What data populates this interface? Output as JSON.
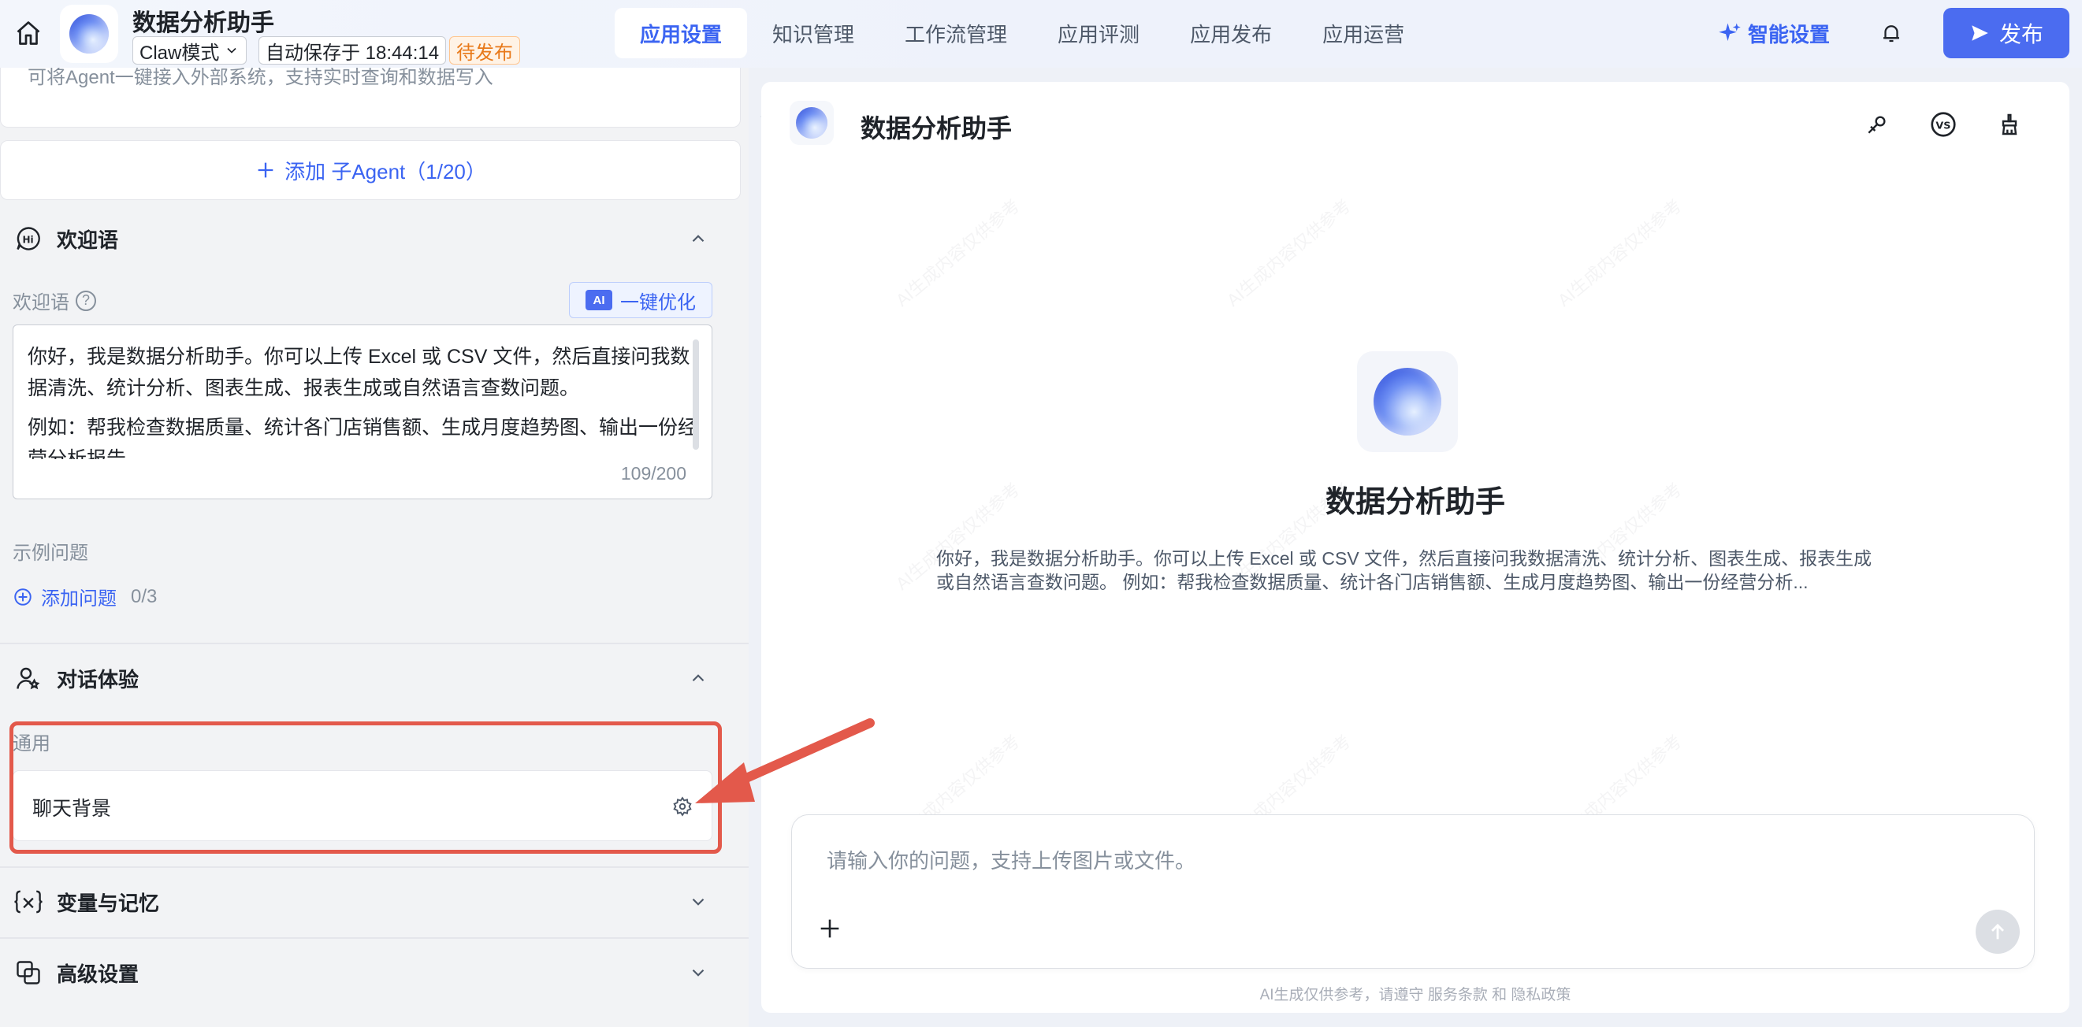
{
  "header": {
    "app_title": "数据分析助手",
    "mode_label": "Claw模式",
    "autosave_text": "自动保存于 18:44:14",
    "status_badge": "待发布",
    "tabs": [
      {
        "label": "应用设置",
        "active": true
      },
      {
        "label": "知识管理",
        "active": false
      },
      {
        "label": "工作流管理",
        "active": false
      },
      {
        "label": "应用评测",
        "active": false
      },
      {
        "label": "应用发布",
        "active": false
      },
      {
        "label": "应用运营",
        "active": false
      }
    ],
    "smart_settings_label": "智能设置",
    "publish_label": "发布",
    "accent_color": "#3b64f2"
  },
  "left": {
    "agent_desc_tail": "可将Agent一键接入外部系统，支持实时查询和数据写入",
    "add_subagent_label": "添加 子Agent（1/20）",
    "welcome_section": {
      "title": "欢迎语",
      "field_label": "欢迎语",
      "optimize_badge": "AI",
      "optimize_label": "一键优化",
      "paragraph1": "你好，我是数据分析助手。你可以上传 Excel 或 CSV 文件，然后直接问我数据清洗、统计分析、图表生成、报表生成或自然语言查数问题。",
      "paragraph2": "例如：帮我检查数据质量、统计各门店销售额、生成月度趋势图、输出一份经营分析报告。",
      "char_count": "109/200",
      "examples_label": "示例问题",
      "add_question_label": "添加问题",
      "question_count": "0/3"
    },
    "dialog_section": {
      "title": "对话体验",
      "general_label": "通用",
      "chat_bg_label": "聊天背景"
    },
    "variables_section": {
      "title": "变量与记忆"
    },
    "advanced_section": {
      "title": "高级设置"
    },
    "highlight_color": "#e3594b"
  },
  "preview": {
    "title": "数据分析助手",
    "center_title": "数据分析助手",
    "center_desc": "你好，我是数据分析助手。你可以上传 Excel 或 CSV 文件，然后直接问我数据清洗、统计分析、图表生成、报表生成或自然语言查数问题。 例如：帮我检查数据质量、统计各门店销售额、生成月度趋势图、输出一份经营分析...",
    "input_placeholder": "请输入你的问题，支持上传图片或文件。",
    "disclaimer": "AI生成仅供参考，请遵守 服务条款 和 隐私政策",
    "watermark": "AI生成内容仅供参考"
  }
}
